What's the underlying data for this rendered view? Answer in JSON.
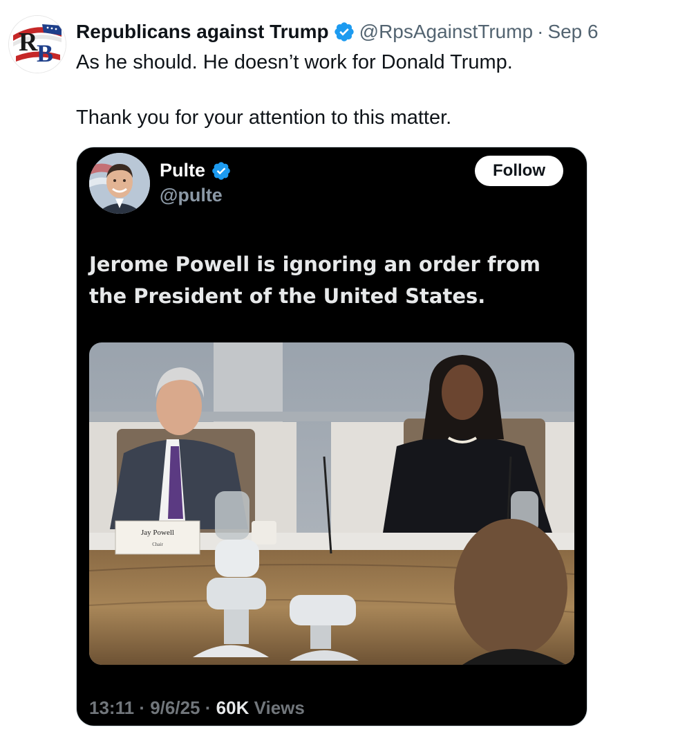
{
  "tweet": {
    "avatar_initials": "RB",
    "display_name": "Republicans against Trump",
    "handle": "@RpsAgainstTrump",
    "separator": "·",
    "date": "Sep 6",
    "lines": [
      "As he should. He doesn’t work for Donald Trump.",
      "Thank you for your attention to this matter."
    ]
  },
  "quoted": {
    "display_name": "Pulte",
    "handle": "@pulte",
    "follow_label": "Follow",
    "text": "Jerome Powell is ignoring an order from the President of the United States.",
    "photo": {
      "nameplate_name": "Jay Powell",
      "nameplate_title": "Chair"
    },
    "footer": {
      "time": "13:11",
      "sep1": "·",
      "date": "9/6/25",
      "sep2": "·",
      "views_count": "60K",
      "views_label": "Views"
    }
  },
  "colors": {
    "verified_blue": "#1d9bf0",
    "embed_bg": "#000000",
    "secondary_text": "#536471"
  },
  "icons": {
    "verified": "verified-badge-icon"
  }
}
